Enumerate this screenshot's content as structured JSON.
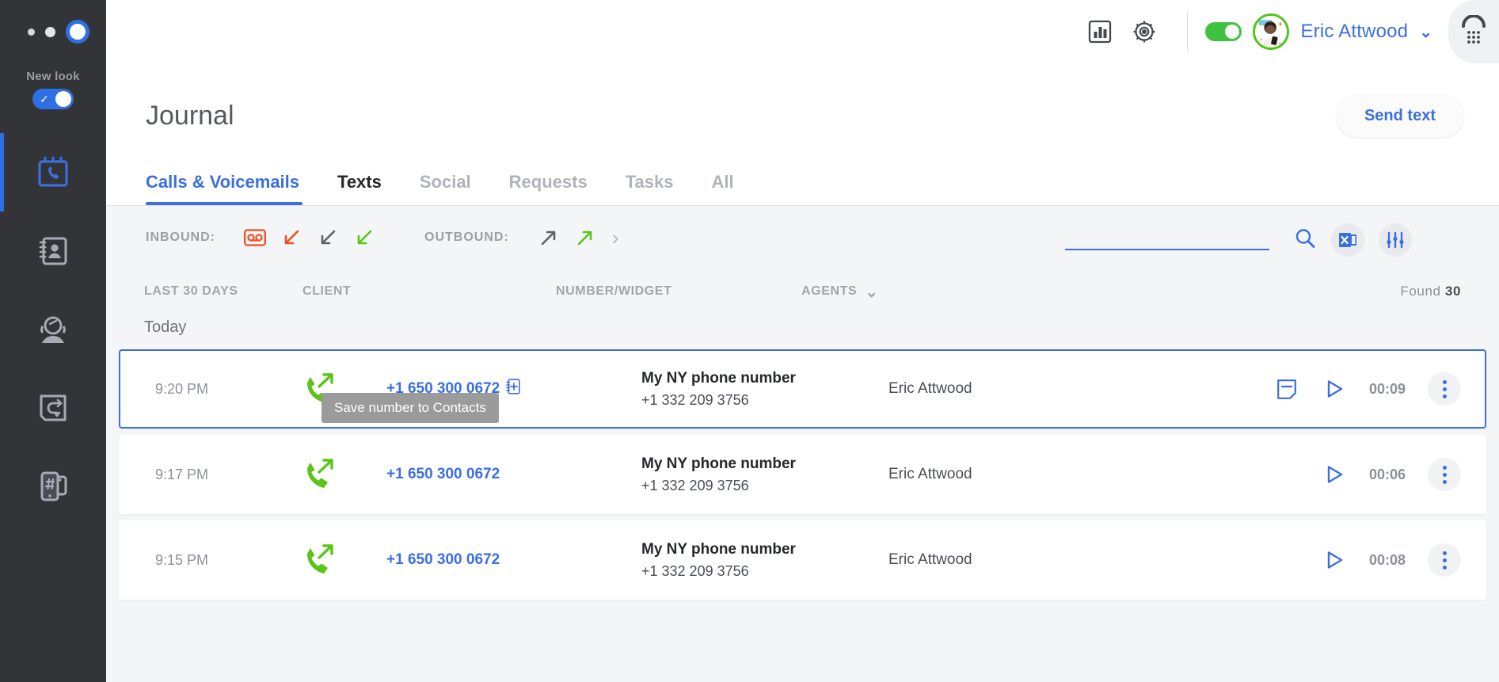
{
  "rail": {
    "new_look_label": "New look",
    "new_look_enabled": "on",
    "items": [
      {
        "name": "journal",
        "icon": "calendar-phone-icon",
        "active": true
      },
      {
        "name": "contacts",
        "icon": "address-book-icon",
        "active": false
      },
      {
        "name": "agents",
        "icon": "headset-agent-icon",
        "active": false
      },
      {
        "name": "routing",
        "icon": "call-flow-icon",
        "active": false
      },
      {
        "name": "numbers",
        "icon": "phone-hash-icon",
        "active": false
      }
    ]
  },
  "header": {
    "stats_icon": "bar-chart-icon",
    "settings_icon": "gear-icon",
    "availability_toggle": "on",
    "user_name": "Eric Attwood",
    "chevron": "⌄",
    "dialpad_icon": "dialpad-icon"
  },
  "page": {
    "title": "Journal",
    "send_text_label": "Send text"
  },
  "tabs": [
    {
      "label": "Calls & Voicemails",
      "state": "active"
    },
    {
      "label": "Texts",
      "state": "strong"
    },
    {
      "label": "Social",
      "state": "muted"
    },
    {
      "label": "Requests",
      "state": "muted"
    },
    {
      "label": "Tasks",
      "state": "muted"
    },
    {
      "label": "All",
      "state": "muted"
    }
  ],
  "filters": {
    "inbound_label": "INBOUND:",
    "outbound_label": "OUTBOUND:",
    "inbound_icons": [
      "voicemail-icon",
      "missed-call-icon",
      "declined-call-icon",
      "answered-call-icon"
    ],
    "outbound_icons": [
      "outbound-unanswered-icon",
      "outbound-answered-icon"
    ],
    "more_chevron": "›"
  },
  "search": {
    "value": "",
    "placeholder": "",
    "search_icon": "search-icon",
    "excel_icon": "excel-export-icon",
    "sliders_icon": "filter-sliders-icon"
  },
  "table": {
    "headers": {
      "time": "LAST 30 DAYS",
      "client": "CLIENT",
      "widget": "NUMBER/WIDGET",
      "agents": "AGENTS",
      "agents_chevron": "⌄"
    },
    "found_label": "Found",
    "found_count": "30",
    "day_group": "Today",
    "rows": [
      {
        "time": "9:20 PM",
        "direction_icon": "outbound-answered-call-icon",
        "client_number": "+1 650 300 0672",
        "has_add_contact": true,
        "widget_title": "My NY phone number",
        "widget_number": "+1 332 209 3756",
        "agent": "Eric Attwood",
        "has_note": true,
        "play_icon": "play-icon",
        "duration": "00:09",
        "selected": true
      },
      {
        "time": "9:17 PM",
        "direction_icon": "outbound-answered-call-icon",
        "client_number": "+1 650 300 0672",
        "has_add_contact": false,
        "widget_title": "My NY phone number",
        "widget_number": "+1 332 209 3756",
        "agent": "Eric Attwood",
        "has_note": false,
        "play_icon": "play-icon",
        "duration": "00:06",
        "selected": false
      },
      {
        "time": "9:15 PM",
        "direction_icon": "outbound-answered-call-icon",
        "client_number": "+1 650 300 0672",
        "has_add_contact": false,
        "widget_title": "My NY phone number",
        "widget_number": "+1 332 209 3756",
        "agent": "Eric Attwood",
        "has_note": false,
        "play_icon": "play-icon",
        "duration": "00:08",
        "selected": false
      }
    ]
  },
  "tooltip": {
    "text": "Save number to Contacts"
  },
  "colors": {
    "accent_blue": "#3b6fe0",
    "green": "#5cc417",
    "red": "#ef4e23",
    "gray": "#6b6e74",
    "rail_bg": "#333437",
    "page_bg": "#f4f5f7"
  }
}
